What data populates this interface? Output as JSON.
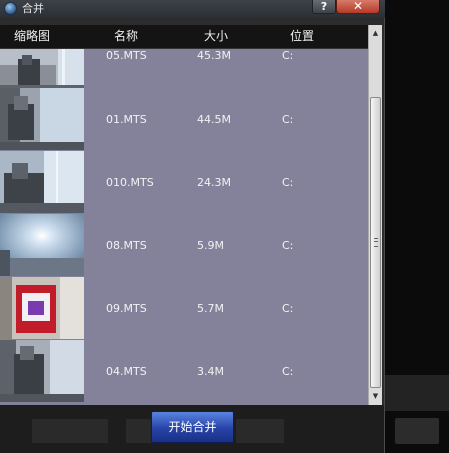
{
  "window": {
    "title": "合并"
  },
  "titlebar": {
    "help_label": "?",
    "close_label": "✕"
  },
  "columns": {
    "thumbnail": "缩略图",
    "name": "名称",
    "size": "大小",
    "location": "位置"
  },
  "files": [
    {
      "name": "05.MTS",
      "size": "45.3M",
      "location": "C:"
    },
    {
      "name": "01.MTS",
      "size": "44.5M",
      "location": "C:"
    },
    {
      "name": "010.MTS",
      "size": "24.3M",
      "location": "C:"
    },
    {
      "name": "08.MTS",
      "size": "5.9M",
      "location": "C:"
    },
    {
      "name": "09.MTS",
      "size": "5.7M",
      "location": "C:"
    },
    {
      "name": "04.MTS",
      "size": "3.4M",
      "location": "C:"
    }
  ],
  "footer": {
    "start_merge_label": "开始合并"
  },
  "colors": {
    "list_background": "#84829a",
    "header_background": "#141414",
    "button_accent": "#2744a8"
  }
}
